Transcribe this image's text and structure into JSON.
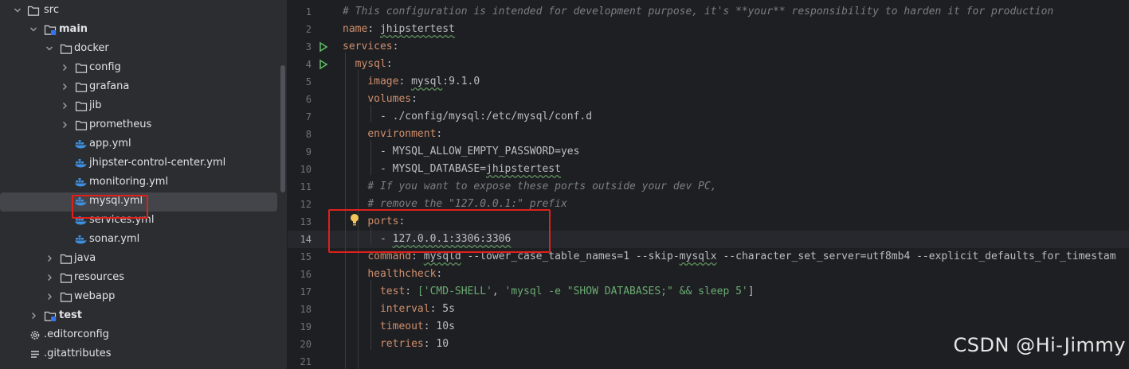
{
  "tree": {
    "items": [
      {
        "label": "src",
        "type": "folder",
        "expanded": true,
        "bold": false
      },
      {
        "label": "main",
        "type": "module-folder",
        "expanded": true,
        "bold": true
      },
      {
        "label": "docker",
        "type": "folder",
        "expanded": true,
        "bold": false
      },
      {
        "label": "config",
        "type": "folder",
        "expanded": false,
        "bold": false
      },
      {
        "label": "grafana",
        "type": "folder",
        "expanded": false,
        "bold": false
      },
      {
        "label": "jib",
        "type": "folder",
        "expanded": false,
        "bold": false
      },
      {
        "label": "prometheus",
        "type": "folder",
        "expanded": false,
        "bold": false
      },
      {
        "label": "app.yml",
        "type": "docker-file",
        "bold": false
      },
      {
        "label": "jhipster-control-center.yml",
        "type": "docker-file",
        "bold": false
      },
      {
        "label": "monitoring.yml",
        "type": "docker-file",
        "bold": false
      },
      {
        "label": "mysql.yml",
        "type": "docker-file",
        "bold": false,
        "selected": true
      },
      {
        "label": "services.yml",
        "type": "docker-file",
        "bold": false
      },
      {
        "label": "sonar.yml",
        "type": "docker-file",
        "bold": false
      },
      {
        "label": "java",
        "type": "folder",
        "expanded": false,
        "bold": false
      },
      {
        "label": "resources",
        "type": "folder",
        "expanded": false,
        "bold": false
      },
      {
        "label": "webapp",
        "type": "folder",
        "expanded": false,
        "bold": false
      },
      {
        "label": "test",
        "type": "module-folder",
        "expanded": false,
        "bold": true
      },
      {
        "label": ".editorconfig",
        "type": "gear-file",
        "bold": false
      },
      {
        "label": ".gitattributes",
        "type": "lines-file",
        "bold": false
      }
    ]
  },
  "editor": {
    "line_numbers": [
      "1",
      "2",
      "3",
      "4",
      "5",
      "6",
      "7",
      "8",
      "9",
      "10",
      "11",
      "12",
      "13",
      "14",
      "15",
      "16",
      "17",
      "18",
      "19",
      "20",
      "21"
    ],
    "current_line": "14",
    "lines": {
      "l1": "# This configuration is intended for development purpose, it's **your** responsibility to harden it for production",
      "l2_key": "name",
      "l2_val": "jhipstertest",
      "l3_key": "services",
      "l4_key": "mysql",
      "l5_key": "image",
      "l5_val_a": "mysql",
      "l5_val_b": ":9.1.0",
      "l6_key": "volumes",
      "l7_val": "- ./config/mysql:/etc/mysql/conf.d",
      "l8_key": "environment",
      "l9_val": "- MYSQL_ALLOW_EMPTY_PASSWORD=yes",
      "l10_val_a": "- MYSQL_DATABASE=",
      "l10_val_b": "jhipstertest",
      "l11": "# If you want to expose these ports outside your dev PC,",
      "l12": "# remove the \"127.0.0.1:\" prefix",
      "l13_key": "ports",
      "l14_val_a": "- ",
      "l14_val_b": "127.0.0.1:3306:3306",
      "l15_key": "command",
      "l15_val_a": "mysqld",
      "l15_val_b": " --lower_case_table_names=1 --skip-",
      "l15_val_c": "mysqlx",
      "l15_val_d": " --character_set_server=utf8mb4 --explicit_defaults_for_timestam",
      "l16_key": "healthcheck",
      "l17_key": "test",
      "l17_a": "['CMD-SHELL'",
      "l17_b": ", ",
      "l17_c": "'mysql -e \"SHOW DATABASES;\" && sleep 5'",
      "l17_d": "]",
      "l18_key": "interval",
      "l18_val": "5s",
      "l19_key": "timeout",
      "l19_val": "10s",
      "l20_key": "retries",
      "l20_val": "10"
    }
  },
  "watermark": "CSDN @Hi-Jimmy",
  "colors": {
    "key": "#cf8e6d",
    "string": "#6aab73",
    "comment": "#7a7e85",
    "highlight_box": "#e0201b",
    "selection": "#43454a"
  }
}
